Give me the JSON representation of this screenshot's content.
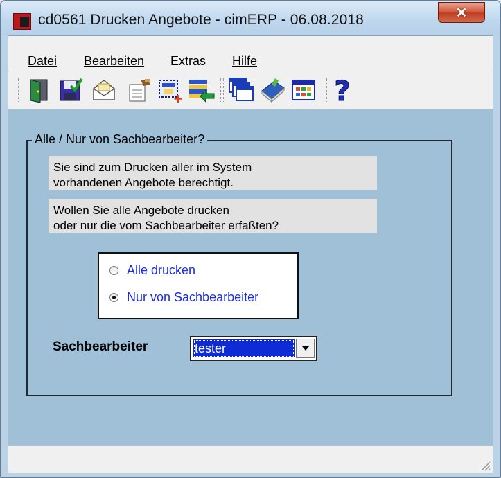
{
  "window": {
    "title": "cd0561 Drucken Angebote - cimERP - 06.08.2018",
    "close_label": "✕"
  },
  "menu": {
    "items": [
      "Datei",
      "Bearbeiten",
      "Extras",
      "Hilfe"
    ]
  },
  "toolbar": {
    "buttons": [
      "exit-door-icon",
      "save-icon",
      "mail-icon",
      "edit-document-icon",
      "select-add-icon",
      "import-list-icon",
      "windows-icon",
      "book-icon",
      "grid-table-icon",
      "help-icon"
    ]
  },
  "group": {
    "legend": "Alle / Nur von Sachbearbeiter?",
    "info1_line1": "Sie sind zum Drucken aller im System",
    "info1_line2": "vorhandenen Angebote berechtigt.",
    "info2_line1": "Wollen Sie alle Angebote drucken",
    "info2_line2": "oder nur die vom Sachbearbeiter erfaßten?",
    "options": [
      "Alle drucken",
      "Nur von Sachbearbeiter"
    ],
    "selected_option": "Nur von Sachbearbeiter",
    "sb_label": "Sachbearbeiter",
    "sb_value": "tester"
  },
  "colors": {
    "client_bg": "#a0c0d8",
    "selection": "#0f2bd6",
    "radio_text": "#1b2be8"
  }
}
